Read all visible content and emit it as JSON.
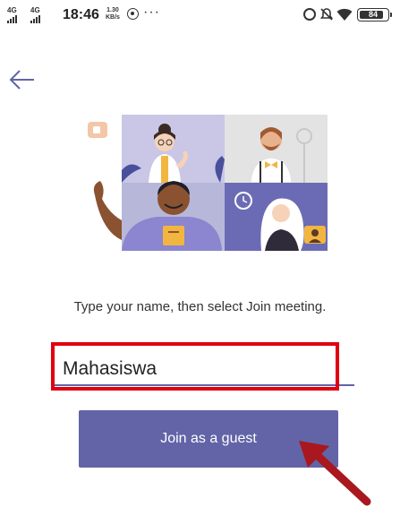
{
  "status_bar": {
    "network_1": "4G",
    "network_2": "4G",
    "time": "18:46",
    "speed_value": "1.30",
    "speed_unit": "KB/s",
    "overflow": "···",
    "battery": "84",
    "icons": [
      "signal-icon",
      "whatsapp-icon",
      "alarm-icon",
      "mute-icon",
      "wifi-icon",
      "battery-icon"
    ]
  },
  "nav": {
    "back_icon": "arrow-left-icon"
  },
  "instruction": "Type your name, then select Join meeting.",
  "name_input": {
    "value": "Mahasiswa"
  },
  "join_button": {
    "label": "Join as a guest"
  },
  "colors": {
    "accent": "#6264a7",
    "highlight": "#e0000f",
    "annotation_arrow": "#a8181e"
  }
}
